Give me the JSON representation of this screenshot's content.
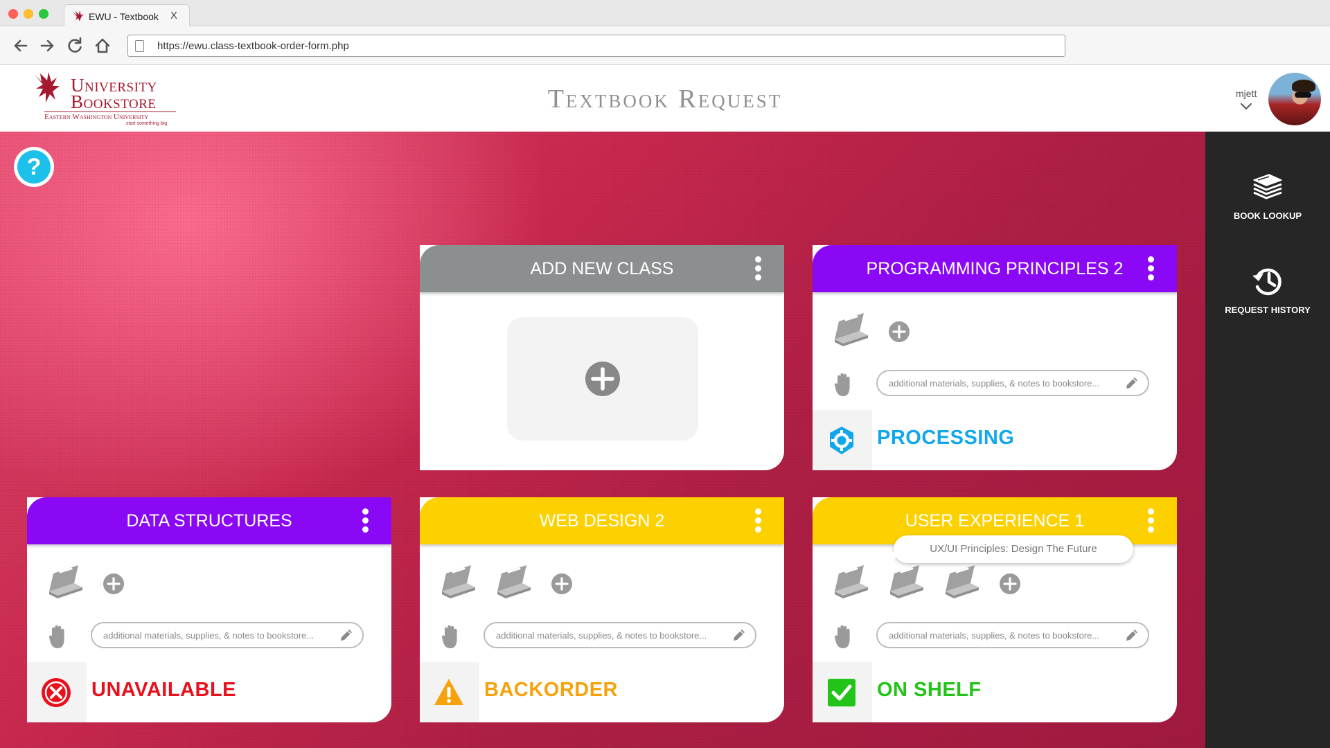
{
  "browser": {
    "tab_title": "EWU - Textbook",
    "tab_close": "X",
    "url": "https://ewu.class-textbook-order-form.php"
  },
  "header": {
    "logo": {
      "line1": "University",
      "line2": "Bookstore",
      "line3": "Eastern Washington University",
      "tagline": "start something big"
    },
    "title": "Textbook Request",
    "username": "mjett"
  },
  "help": {
    "label": "?"
  },
  "sidebar": {
    "items": [
      {
        "label": "BOOK LOOKUP",
        "icon": "book-stack-icon"
      },
      {
        "label": "REQUEST HISTORY",
        "icon": "history-icon"
      }
    ]
  },
  "cards": [
    {
      "id": "add-new-class",
      "title": "ADD NEW CLASS",
      "color": "#8c8f90"
    },
    {
      "id": "programming-principles-2",
      "title": "PROGRAMMING PRINCIPLES 2",
      "color": "#8a08f6",
      "book_count": 1,
      "notes_placeholder": "additional materials, supplies, & notes to bookstore...",
      "status": "PROCESSING",
      "status_color": "#11a7ea",
      "status_icon": "gear-icon"
    },
    {
      "id": "data-structures",
      "title": "DATA STRUCTURES",
      "color": "#8a08f6",
      "book_count": 1,
      "notes_placeholder": "additional materials, supplies, & notes to bookstore...",
      "status": "UNAVAILABLE",
      "status_color": "#e8101c",
      "status_icon": "x-circle-icon"
    },
    {
      "id": "web-design-2",
      "title": "WEB DESIGN 2",
      "color": "#fdd100",
      "book_count": 2,
      "notes_placeholder": "additional materials, supplies, & notes to bookstore...",
      "status": "BACKORDER",
      "status_color": "#f6a20c",
      "status_icon": "warning-icon"
    },
    {
      "id": "user-experience-1",
      "title": "USER EXPERIENCE 1",
      "color": "#fdd100",
      "book_count": 3,
      "notes_placeholder": "additional materials, supplies, & notes to bookstore...",
      "status": "ON SHELF",
      "status_color": "#22c418",
      "status_icon": "checkbox-icon"
    }
  ],
  "tooltip": {
    "text": "UX/UI Principles: Design The Future"
  }
}
